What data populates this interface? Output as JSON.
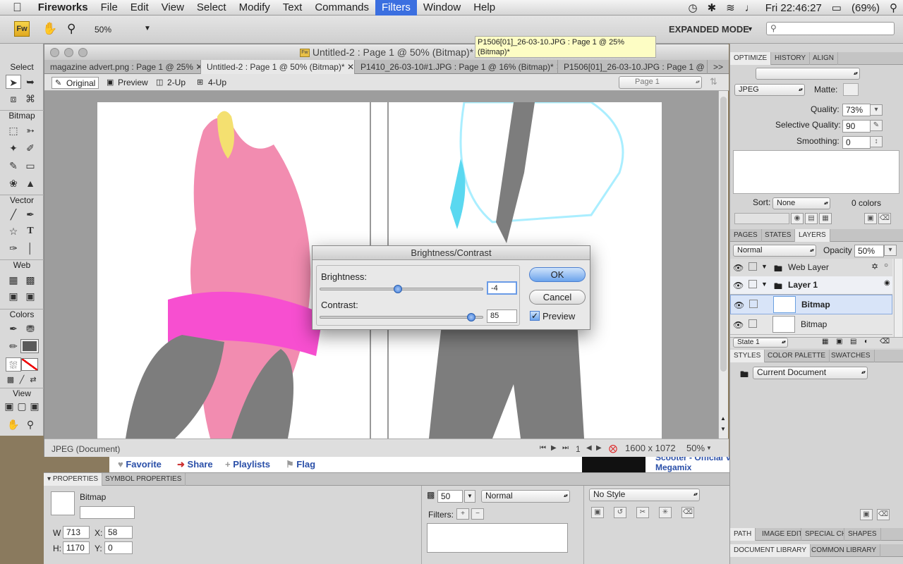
{
  "menubar": {
    "items": [
      "Fireworks",
      "File",
      "Edit",
      "View",
      "Select",
      "Modify",
      "Text",
      "Commands",
      "Filters",
      "Window",
      "Help"
    ],
    "active": "Filters",
    "clock": "Fri 22:46:27",
    "battery": "(69%)"
  },
  "appbar": {
    "logo": "Fw",
    "zoom": "50%",
    "mode": "EXPANDED MODE",
    "search_placeholder": ""
  },
  "tools": {
    "sections": [
      "Select",
      "Bitmap",
      "Vector",
      "Web",
      "Colors",
      "View"
    ]
  },
  "document": {
    "title": "Untitled-2 : Page 1 @ 50% (Bitmap)*",
    "tabs": [
      {
        "label": "magazine advert.png : Page 1 @ 25%",
        "active": false
      },
      {
        "label": "Untitled-2 : Page 1 @ 50% (Bitmap)*",
        "active": true
      },
      {
        "label": "P1410_26-03-10#1.JPG : Page 1 @ 16% (Bitmap)*",
        "active": false
      },
      {
        "label": "P1506[01]_26-03-10.JPG : Page 1 @ 25%",
        "active": false
      }
    ],
    "tabs_overflow": ">>",
    "views": [
      "Original",
      "Preview",
      "2-Up",
      "4-Up"
    ],
    "active_view": "Original",
    "page": "Page 1",
    "status_format": "JPEG (Document)",
    "frame": "1",
    "dimensions": "1600 x 1072",
    "zoom": "50%"
  },
  "tooltip": "P1506[01]_26-03-10.JPG : Page 1 @ 25% (Bitmap)*",
  "dialog": {
    "title": "Brightness/Contrast",
    "brightness_label": "Brightness:",
    "brightness_value": "-4",
    "brightness_level": -4,
    "contrast_label": "Contrast:",
    "contrast_value": "85",
    "contrast_level": 85,
    "ok": "OK",
    "cancel": "Cancel",
    "preview": "Preview",
    "preview_checked": true
  },
  "background_page": {
    "links": [
      "Favorite",
      "Share",
      "Playlists",
      "Flag"
    ],
    "video_title": "Scooter - Official V",
    "video_sub": "Megamix"
  },
  "properties": {
    "tabs": [
      "PROPERTIES",
      "SYMBOL PROPERTIES"
    ],
    "type": "Bitmap",
    "name_value": "",
    "w_label": "W",
    "w": "713",
    "h_label": "H:",
    "h": "1170",
    "x_label": "X:",
    "x": "58",
    "y_label": "Y:",
    "y": "0",
    "opacity": "50",
    "blend": "Normal",
    "filters_label": "Filters:",
    "style": "No Style"
  },
  "optimize": {
    "tabs": [
      "OPTIMIZE",
      "HISTORY",
      "ALIGN"
    ],
    "preset": "",
    "format": "JPEG",
    "matte_label": "Matte:",
    "quality_label": "Quality:",
    "quality": "73%",
    "selective_label": "Selective Quality:",
    "selective": "90",
    "smoothing_label": "Smoothing:",
    "smoothing": "0",
    "sort_label": "Sort:",
    "sort": "None",
    "colors": "0 colors"
  },
  "layers": {
    "tabs": [
      "PAGES",
      "STATES",
      "LAYERS"
    ],
    "blend": "Normal",
    "opacity_label": "Opacity",
    "opacity": "50%",
    "rows": [
      {
        "name": "Web Layer",
        "kind": "folder"
      },
      {
        "name": "Layer 1",
        "kind": "folder"
      },
      {
        "name": "Bitmap",
        "kind": "bitmap"
      },
      {
        "name": "Bitmap",
        "kind": "bitmap"
      }
    ],
    "state": "State 1"
  },
  "styles": {
    "tabs": [
      "STYLES",
      "COLOR PALETTE",
      "SWATCHES"
    ],
    "source": "Current Document"
  },
  "bottom_tabs": {
    "row1": [
      "PATH",
      "IMAGE EDIT",
      "SPECIAL CH",
      "SHAPES"
    ],
    "row2": [
      "DOCUMENT LIBRARY",
      "COMMON LIBRARY"
    ]
  },
  "colors": {
    "accent": "#3b6fe0",
    "dialog_ok": "#6ba3ec",
    "tooltip": "#fdfdc4"
  }
}
